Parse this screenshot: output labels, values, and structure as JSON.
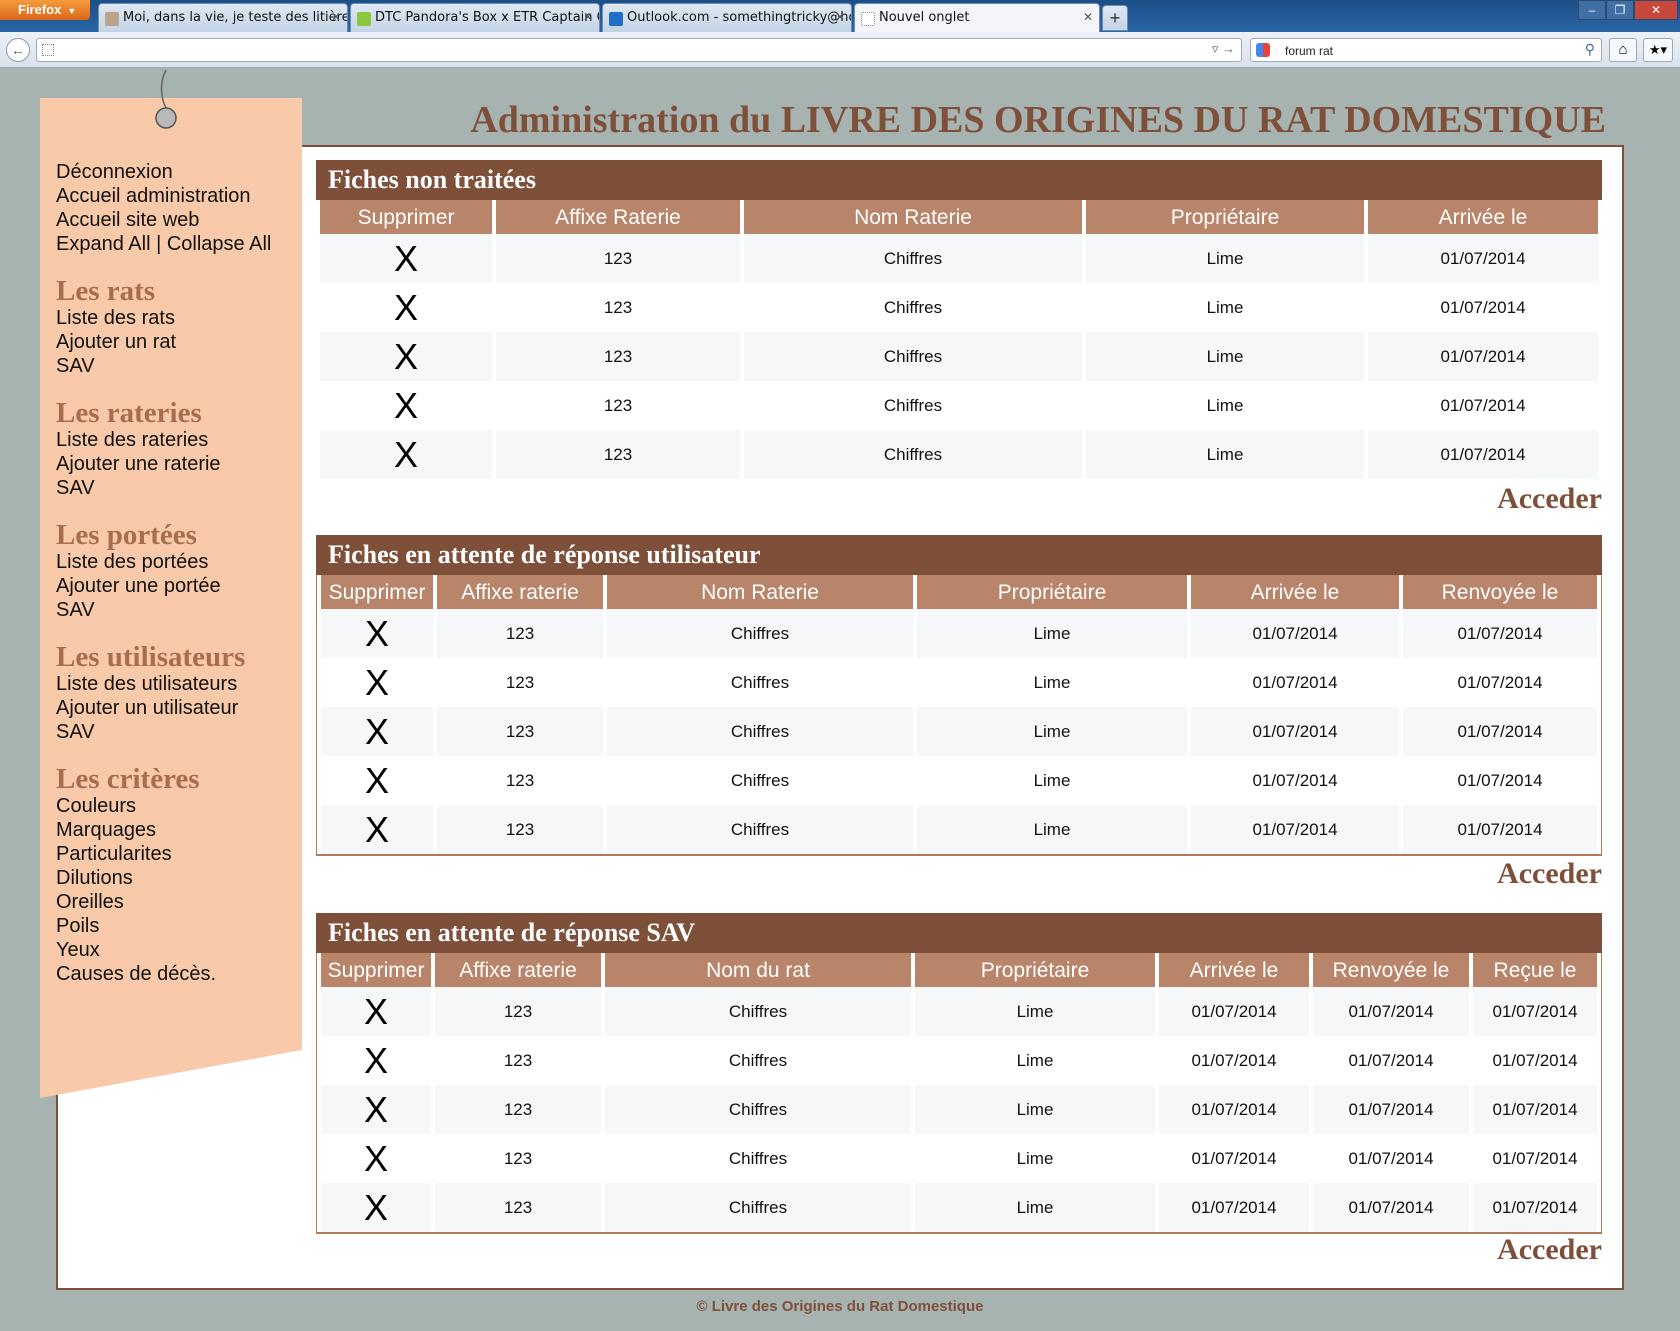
{
  "browser": {
    "menu_button": "Firefox",
    "tabs": [
      {
        "title": "Moi, dans la vie, je teste des litières >...",
        "icon": "rat-icon"
      },
      {
        "title": "DTC Pandora's Box x ETR Captain Ob...",
        "icon": "speech-bubble-icon"
      },
      {
        "title": "Outlook.com - somethingtricky@hot...",
        "icon": "outlook-icon"
      },
      {
        "title": "Nouvel onglet",
        "icon": "blank-page-icon"
      }
    ],
    "new_tab_label": "+",
    "url_value": "",
    "search_value": "forum rat"
  },
  "page": {
    "title": "Administration du LIVRE DES ORIGINES DU RAT DOMESTIQUE",
    "footer": "© Livre des Origines du Rat Domestique"
  },
  "sidebar": {
    "top_links": [
      "Déconnexion",
      "Accueil administration",
      "Accueil site web"
    ],
    "expand_all": "Expand All",
    "separator": "|",
    "collapse_all": "Collapse All",
    "groups": [
      {
        "title": "Les rats",
        "links": [
          "Liste des rats",
          "Ajouter un rat",
          "SAV"
        ]
      },
      {
        "title": "Les rateries",
        "links": [
          "Liste des rateries",
          "Ajouter une raterie",
          "SAV"
        ]
      },
      {
        "title": "Les portées",
        "links": [
          "Liste des portées",
          "Ajouter une portée",
          "SAV"
        ]
      },
      {
        "title": "Les utilisateurs",
        "links": [
          "Liste des utilisateurs",
          "Ajouter un utilisateur",
          "SAV"
        ]
      },
      {
        "title": "Les critères",
        "links": [
          "Couleurs",
          "Marquages",
          "Particularites",
          "Dilutions",
          "Oreilles",
          "Poils",
          "Yeux",
          "Causes de décès."
        ]
      }
    ]
  },
  "panels": [
    {
      "title": "Fiches non traitées",
      "columns": [
        "Supprimer",
        "Affixe Raterie",
        "Nom Raterie",
        "Propriétaire",
        "Arrivée le"
      ],
      "rows": [
        [
          "X",
          "123",
          "Chiffres",
          "Lime",
          "01/07/2014"
        ],
        [
          "X",
          "123",
          "Chiffres",
          "Lime",
          "01/07/2014"
        ],
        [
          "X",
          "123",
          "Chiffres",
          "Lime",
          "01/07/2014"
        ],
        [
          "X",
          "123",
          "Chiffres",
          "Lime",
          "01/07/2014"
        ],
        [
          "X",
          "123",
          "Chiffres",
          "Lime",
          "01/07/2014"
        ]
      ],
      "link": "Acceder"
    },
    {
      "title": "Fiches en attente de réponse utilisateur",
      "columns": [
        "Supprimer",
        "Affixe raterie",
        "Nom Raterie",
        "Propriétaire",
        "Arrivée le",
        "Renvoyée le"
      ],
      "rows": [
        [
          "X",
          "123",
          "Chiffres",
          "Lime",
          "01/07/2014",
          "01/07/2014"
        ],
        [
          "X",
          "123",
          "Chiffres",
          "Lime",
          "01/07/2014",
          "01/07/2014"
        ],
        [
          "X",
          "123",
          "Chiffres",
          "Lime",
          "01/07/2014",
          "01/07/2014"
        ],
        [
          "X",
          "123",
          "Chiffres",
          "Lime",
          "01/07/2014",
          "01/07/2014"
        ],
        [
          "X",
          "123",
          "Chiffres",
          "Lime",
          "01/07/2014",
          "01/07/2014"
        ]
      ],
      "link": "Acceder"
    },
    {
      "title": "Fiches en attente de réponse SAV",
      "columns": [
        "Supprimer",
        "Affixe raterie",
        "Nom du rat",
        "Propriétaire",
        "Arrivée le",
        "Renvoyée le",
        "Reçue le"
      ],
      "rows": [
        [
          "X",
          "123",
          "Chiffres",
          "Lime",
          "01/07/2014",
          "01/07/2014",
          "01/07/2014"
        ],
        [
          "X",
          "123",
          "Chiffres",
          "Lime",
          "01/07/2014",
          "01/07/2014",
          "01/07/2014"
        ],
        [
          "X",
          "123",
          "Chiffres",
          "Lime",
          "01/07/2014",
          "01/07/2014",
          "01/07/2014"
        ],
        [
          "X",
          "123",
          "Chiffres",
          "Lime",
          "01/07/2014",
          "01/07/2014",
          "01/07/2014"
        ],
        [
          "X",
          "123",
          "Chiffres",
          "Lime",
          "01/07/2014",
          "01/07/2014",
          "01/07/2014"
        ]
      ],
      "link": "Acceder"
    }
  ],
  "colors": {
    "brand_brown": "#7f5039",
    "header_tan": "#b8846a",
    "sidebar_peach": "#f9caa9",
    "page_bg": "#a7b3b1"
  }
}
